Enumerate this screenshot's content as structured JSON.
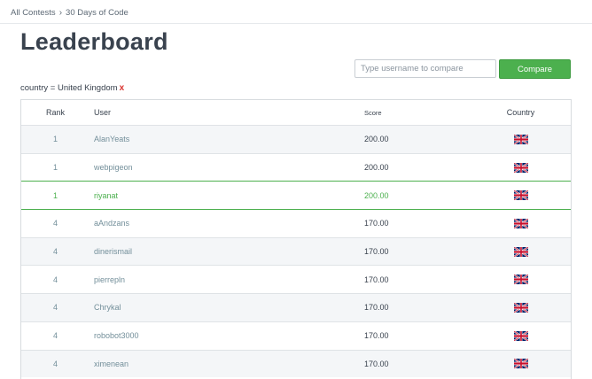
{
  "breadcrumb": {
    "items": [
      "All Contests",
      "30 Days of Code"
    ],
    "separator": "›"
  },
  "page": {
    "title": "Leaderboard"
  },
  "compare": {
    "placeholder": "Type username to compare",
    "button_label": "Compare"
  },
  "filter": {
    "label": "country = United Kingdom",
    "remove": "x"
  },
  "table": {
    "columns": {
      "rank": "Rank",
      "user": "User",
      "score": "Score",
      "country": "Country"
    },
    "rows": [
      {
        "rank": "1",
        "user": "AlanYeats",
        "score": "200.00",
        "country_icon": "uk-flag-icon"
      },
      {
        "rank": "1",
        "user": "webpigeon",
        "score": "200.00",
        "country_icon": "uk-flag-icon"
      },
      {
        "rank": "1",
        "user": "riyanat",
        "score": "200.00",
        "country_icon": "uk-flag-icon",
        "highlighted": true
      },
      {
        "rank": "4",
        "user": "aAndzans",
        "score": "170.00",
        "country_icon": "uk-flag-icon"
      },
      {
        "rank": "4",
        "user": "dinerismail",
        "score": "170.00",
        "country_icon": "uk-flag-icon"
      },
      {
        "rank": "4",
        "user": "pierrepln",
        "score": "170.00",
        "country_icon": "uk-flag-icon"
      },
      {
        "rank": "4",
        "user": "Chrykal",
        "score": "170.00",
        "country_icon": "uk-flag-icon"
      },
      {
        "rank": "4",
        "user": "robobot3000",
        "score": "170.00",
        "country_icon": "uk-flag-icon"
      },
      {
        "rank": "4",
        "user": "ximenean",
        "score": "170.00",
        "country_icon": "uk-flag-icon"
      }
    ]
  },
  "colors": {
    "accent": "#4cb04e",
    "text": "#39424e",
    "muted_text": "#738f9a",
    "remove": "#d9332f"
  }
}
